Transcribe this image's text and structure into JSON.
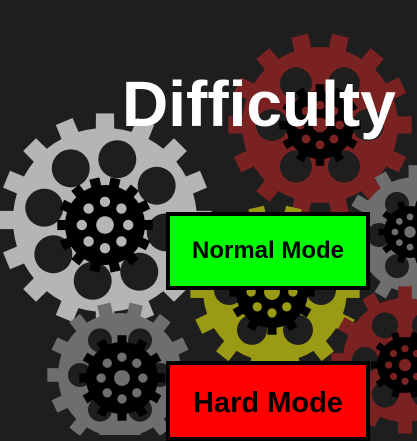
{
  "screen": {
    "title": "Difficulty",
    "background_color": "#1e1e1e"
  },
  "buttons": {
    "normal": {
      "label": "Normal Mode",
      "color": "#00ff00"
    },
    "hard": {
      "label": "Hard Mode",
      "color": "#ff0000"
    }
  },
  "decoration": {
    "gear_colors": {
      "light_gray": "#b5b5b5",
      "dark_red": "#7a2222",
      "olive": "#9b9a14",
      "gray": "#6e6e6e",
      "hub": "#000000"
    }
  }
}
